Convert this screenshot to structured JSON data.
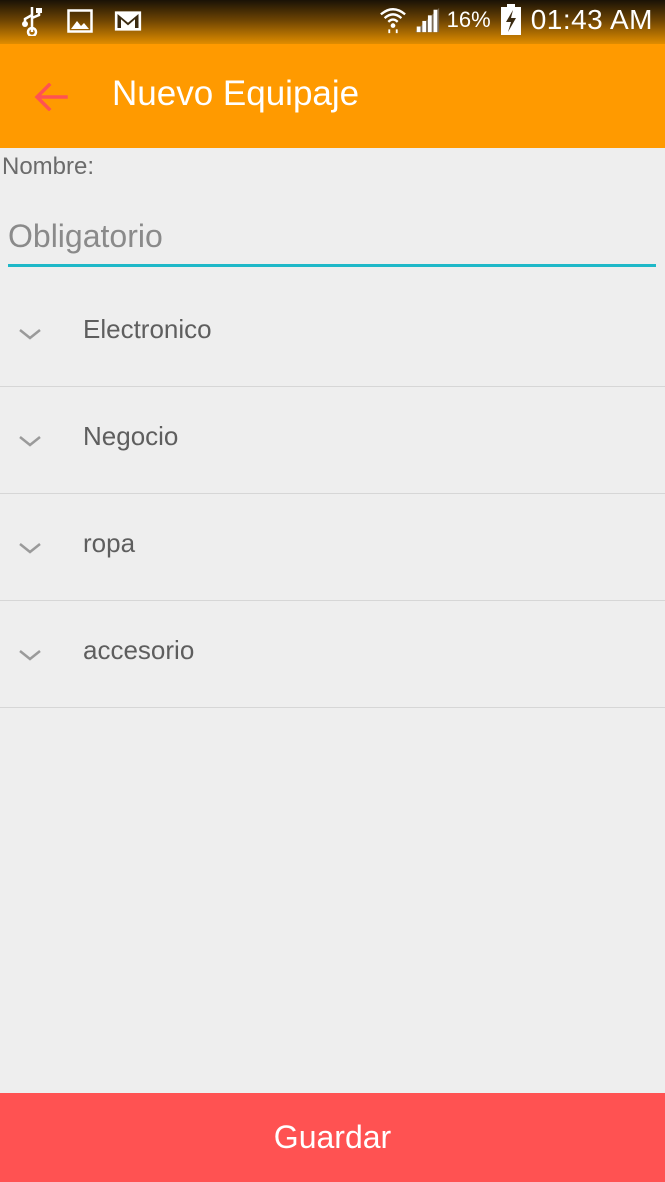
{
  "status_bar": {
    "icons_left": [
      "usb-icon",
      "image-icon",
      "gmail-icon"
    ],
    "icons_right": [
      "wifi-icon",
      "signal-icon",
      "battery-charging-icon"
    ],
    "battery_percent": "16%",
    "time": "01:43 AM"
  },
  "toolbar": {
    "title": "Nuevo Equipaje",
    "back_icon": "arrow-back-icon",
    "back_color": "#ff5252",
    "background": "#ff9a00"
  },
  "form": {
    "name_label": "Nombre:",
    "name_value": "",
    "name_placeholder": "Obligatorio",
    "underline_color": "#1eb8c8"
  },
  "categories": [
    {
      "label": "Electronico",
      "icon": "chevron-down-icon"
    },
    {
      "label": "Negocio",
      "icon": "chevron-down-icon"
    },
    {
      "label": "ropa",
      "icon": "chevron-down-icon"
    },
    {
      "label": "accesorio",
      "icon": "chevron-down-icon"
    }
  ],
  "save_button": {
    "label": "Guardar",
    "background": "#ff5252"
  }
}
